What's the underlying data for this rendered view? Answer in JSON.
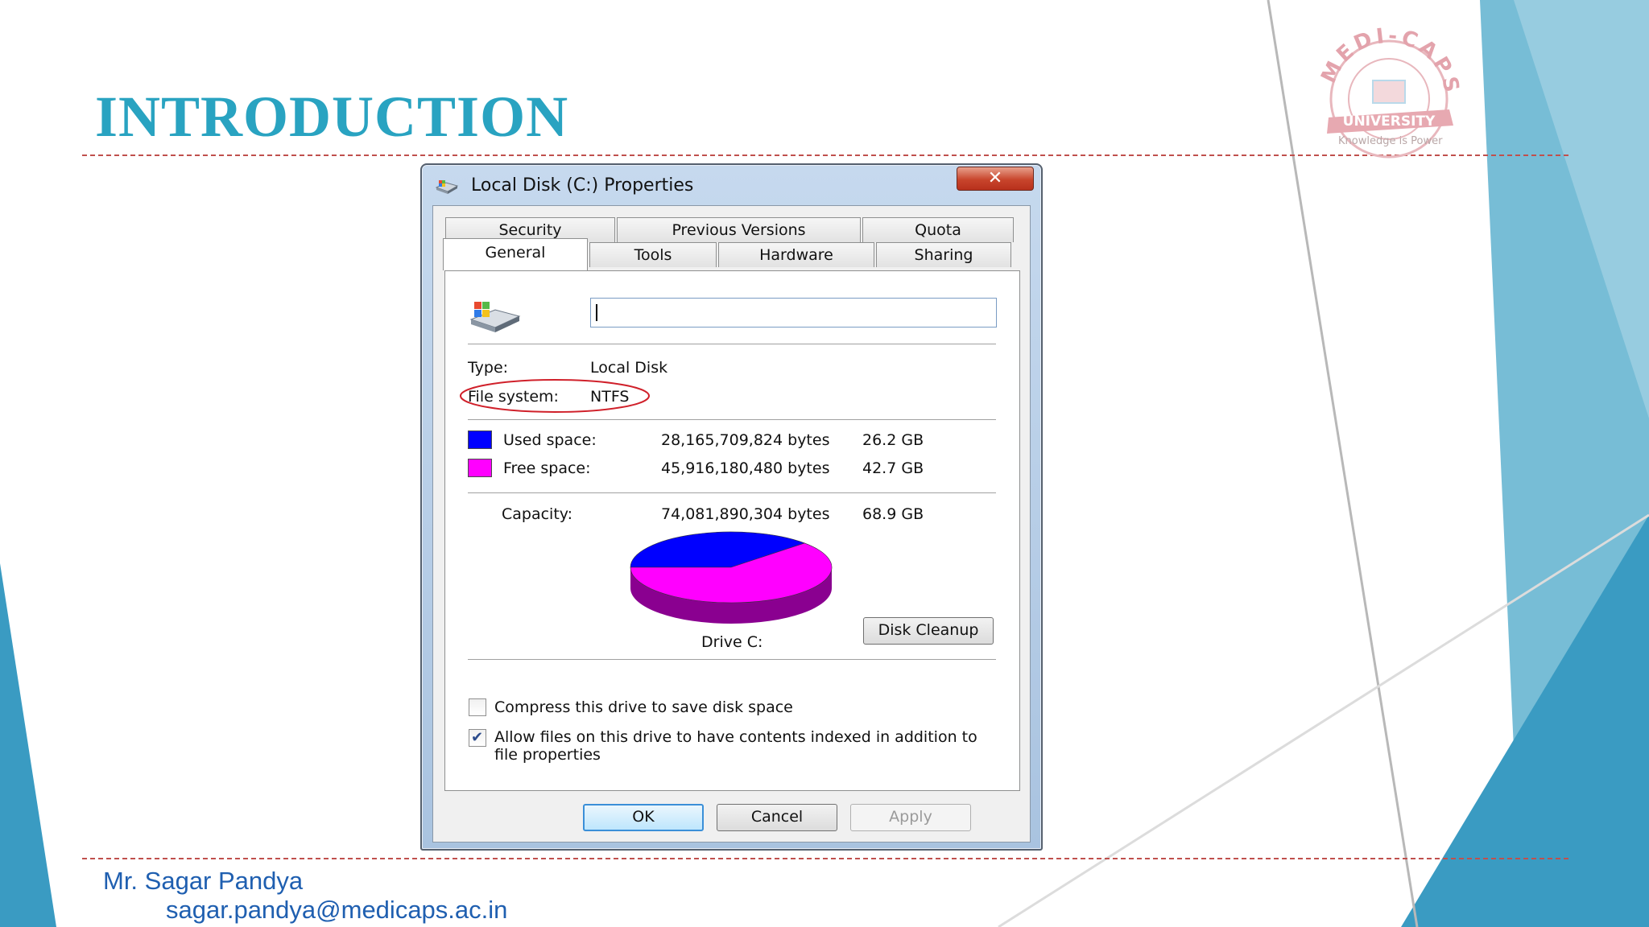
{
  "slide": {
    "title": "INTRODUCTION",
    "author": "Mr. Sagar Pandya",
    "email": "sagar.pandya@medicaps.ac.in",
    "accent_color": "#29a3c1",
    "divider_color": "#c0504d"
  },
  "logo": {
    "arc_text": "MEDI-CAPS",
    "banner_text": "UNIVERSITY",
    "tagline": "Knowledge is Power"
  },
  "dialog": {
    "title": "Local Disk (C:) Properties",
    "close_glyph": "✕",
    "tabs_back": [
      "Security",
      "Previous Versions",
      "Quota"
    ],
    "tabs_front": [
      "General",
      "Tools",
      "Hardware",
      "Sharing"
    ],
    "active_tab": "General",
    "name_value": "",
    "type_label": "Type:",
    "type_value": "Local Disk",
    "fs_label": "File system:",
    "fs_value": "NTFS",
    "used": {
      "label": "Used space:",
      "bytes": "28,165,709,824 bytes",
      "size": "26.2 GB",
      "color": "#0000ff"
    },
    "free": {
      "label": "Free space:",
      "bytes": "45,916,180,480 bytes",
      "size": "42.7 GB",
      "color": "#ff00ff"
    },
    "capacity": {
      "label": "Capacity:",
      "bytes": "74,081,890,304 bytes",
      "size": "68.9 GB"
    },
    "drive_label": "Drive C:",
    "disk_cleanup": "Disk Cleanup",
    "compress": {
      "label": "Compress this drive to save disk space",
      "checked": false
    },
    "index": {
      "label_line1": "Allow files on this drive to have contents indexed in addition to",
      "label_line2": "file properties",
      "checked": true
    },
    "buttons": {
      "ok": "OK",
      "cancel": "Cancel",
      "apply": "Apply"
    }
  },
  "chart_data": {
    "type": "pie",
    "title": "",
    "categories": [
      "Used space",
      "Free space"
    ],
    "values": [
      26.2,
      42.7
    ],
    "colors": [
      "#0000ff",
      "#ff00ff"
    ]
  }
}
